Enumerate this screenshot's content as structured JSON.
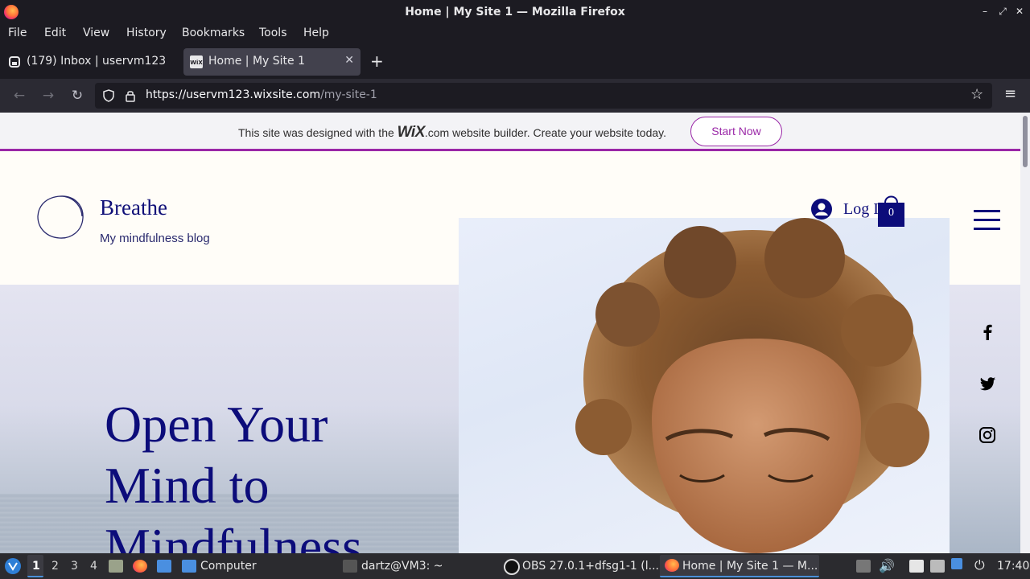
{
  "window": {
    "title": "Home | My Site 1 — Mozilla Firefox",
    "controls": [
      "–",
      "⤢",
      "✕"
    ]
  },
  "menu": [
    "File",
    "Edit",
    "View",
    "History",
    "Bookmarks",
    "Tools",
    "Help"
  ],
  "tabs": [
    {
      "label": "(179) Inbox | uservm123",
      "active": false
    },
    {
      "label": "Home | My Site 1",
      "active": true
    }
  ],
  "nav": {
    "url_host": "https://uservm123.wixsite.com",
    "url_path": "/my-site-1"
  },
  "wix_banner": {
    "text_before": "This site was designed with the ",
    "logo": "WiX",
    "text_after": ".com website builder. Create your website today.",
    "button": "Start Now"
  },
  "site": {
    "brand": "Breathe",
    "tagline": "My mindfulness blog",
    "login": "Log In",
    "cart_count": "0",
    "hero_lines": [
      "Open Your",
      "Mind to",
      "Mindfulness"
    ]
  },
  "taskbar": {
    "workspaces": [
      "1",
      "2",
      "3",
      "4"
    ],
    "items": [
      {
        "label": "Computer"
      },
      {
        "label": "dartz@VM3: ~"
      },
      {
        "label": "OBS 27.0.1+dfsg1-1 (l..."
      },
      {
        "label": "Home | My Site 1 — M..."
      }
    ],
    "clock": "17:40"
  },
  "colors": {
    "accent_purple": "#9a27a7",
    "navy": "#0c0c7a"
  }
}
